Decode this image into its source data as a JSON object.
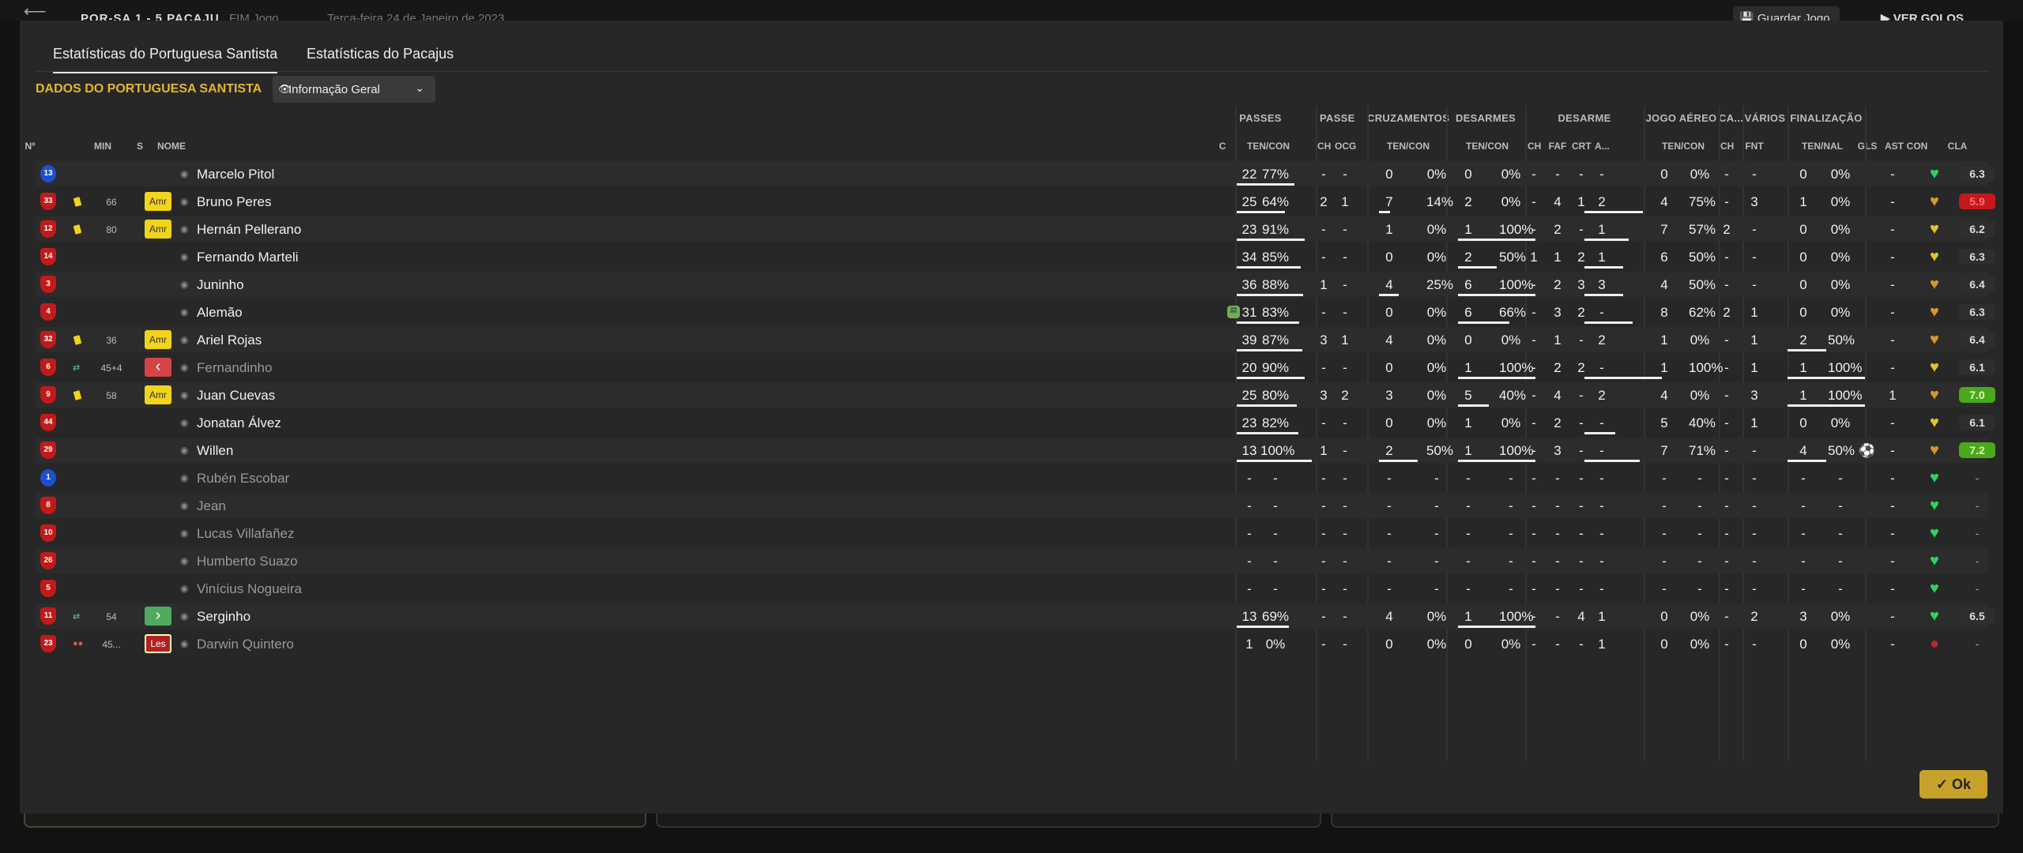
{
  "topbar": {
    "match": "POR-SA  1 - 5  PACAJU",
    "status": "FIM Jogo",
    "date": "Terça-feira 24 de Janeiro de 2023",
    "save": "Guardar Jogo",
    "goals": "VER GOLOS"
  },
  "tabs": [
    "Estatísticas do Portuguesa Santista",
    "Estatísticas do Pacajus"
  ],
  "team_title": "DADOS DO PORTUGUESA SANTISTA",
  "info_button": "Informação Geral",
  "groups": [
    "PASSES",
    "PASSE",
    "CRUZAMENTOS",
    "DESARMES",
    "DESARME",
    "JOGO AÉREO",
    "CA...",
    "VÁRIOS",
    "FINALIZAÇÃO"
  ],
  "columns": [
    "Nº",
    "MIN",
    "S",
    "NOME",
    "C",
    "TEN/CON",
    "CH",
    "OCG",
    "TEN/CON",
    "TEN/CON",
    "CH",
    "FAF",
    "CRT",
    "A...",
    "TEN/CON",
    "CH",
    "FNT",
    "TEN/NAL",
    "GLS",
    "AST",
    "CON",
    "CLA"
  ],
  "players": [
    {
      "num": "13",
      "gk": true,
      "card": false,
      "sub": "",
      "min": "",
      "badge": "",
      "name": "Marcelo Pitol",
      "dim": false,
      "c": false,
      "pass": [
        "22",
        "77%"
      ],
      "pch": "-",
      "ocg": "-",
      "cruz": [
        "0",
        "0%"
      ],
      "des": [
        "0",
        "0%"
      ],
      "dch": "-",
      "faf": "-",
      "crt": "-",
      "a": "-",
      "aer": [
        "0",
        "0%"
      ],
      "cach": "-",
      "fnt": "-",
      "fin": [
        "0",
        "0%"
      ],
      "gls": "",
      "ast": "-",
      "heart": "green",
      "cla": "6.3",
      "cls": "",
      "bars": [
        0.77,
        0,
        0,
        0,
        0,
        0
      ]
    },
    {
      "num": "33",
      "gk": false,
      "card": true,
      "sub": "",
      "min": "66",
      "badge": "Amr",
      "name": "Bruno Peres",
      "dim": false,
      "c": false,
      "pass": [
        "25",
        "64%"
      ],
      "pch": "2",
      "ocg": "1",
      "cruz": [
        "7",
        "14%"
      ],
      "des": [
        "2",
        "0%"
      ],
      "dch": "-",
      "faf": "4",
      "crt": "1",
      "a": "2",
      "aer": [
        "4",
        "75%"
      ],
      "cach": "-",
      "fnt": "3",
      "fin": [
        "1",
        "0%"
      ],
      "gls": "",
      "ast": "-",
      "heart": "orange",
      "cla": "5.9",
      "cls": "red",
      "bars": [
        0.64,
        0,
        0.14,
        0,
        0.75,
        0
      ]
    },
    {
      "num": "12",
      "gk": false,
      "card": true,
      "sub": "",
      "min": "80",
      "badge": "Amr",
      "name": "Hernán Pellerano",
      "dim": false,
      "c": false,
      "pass": [
        "23",
        "91%"
      ],
      "pch": "-",
      "ocg": "-",
      "cruz": [
        "1",
        "0%"
      ],
      "des": [
        "1",
        "100%"
      ],
      "dch": "-",
      "faf": "2",
      "crt": "-",
      "a": "1",
      "aer": [
        "7",
        "57%"
      ],
      "cach": "2",
      "fnt": "-",
      "fin": [
        "0",
        "0%"
      ],
      "gls": "",
      "ast": "-",
      "heart": "yellow",
      "cla": "6.2",
      "cls": "",
      "bars": [
        0.91,
        0,
        0,
        1,
        0.57,
        0
      ]
    },
    {
      "num": "14",
      "gk": false,
      "card": false,
      "sub": "",
      "min": "",
      "badge": "",
      "name": "Fernando Marteli",
      "dim": false,
      "c": false,
      "pass": [
        "34",
        "85%"
      ],
      "pch": "-",
      "ocg": "-",
      "cruz": [
        "0",
        "0%"
      ],
      "des": [
        "2",
        "50%"
      ],
      "dch": "1",
      "faf": "1",
      "crt": "2",
      "a": "1",
      "aer": [
        "6",
        "50%"
      ],
      "cach": "-",
      "fnt": "-",
      "fin": [
        "0",
        "0%"
      ],
      "gls": "",
      "ast": "-",
      "heart": "yellow",
      "cla": "6.3",
      "cls": "",
      "bars": [
        0.85,
        0,
        0,
        0.5,
        0.5,
        0
      ]
    },
    {
      "num": "3",
      "gk": false,
      "card": false,
      "sub": "",
      "min": "",
      "badge": "",
      "name": "Juninho",
      "dim": false,
      "c": false,
      "pass": [
        "36",
        "88%"
      ],
      "pch": "1",
      "ocg": "-",
      "cruz": [
        "4",
        "25%"
      ],
      "des": [
        "6",
        "100%"
      ],
      "dch": "-",
      "faf": "2",
      "crt": "3",
      "a": "3",
      "aer": [
        "4",
        "50%"
      ],
      "cach": "-",
      "fnt": "-",
      "fin": [
        "0",
        "0%"
      ],
      "gls": "",
      "ast": "-",
      "heart": "orange",
      "cla": "6.4",
      "cls": "",
      "bars": [
        0.88,
        0,
        0.25,
        1,
        0.5,
        0
      ]
    },
    {
      "num": "4",
      "gk": false,
      "card": false,
      "sub": "",
      "min": "",
      "badge": "",
      "name": "Alemão",
      "dim": false,
      "c": true,
      "pass": [
        "31",
        "83%"
      ],
      "pch": "-",
      "ocg": "-",
      "cruz": [
        "0",
        "0%"
      ],
      "des": [
        "6",
        "66%"
      ],
      "dch": "-",
      "faf": "3",
      "crt": "2",
      "a": "-",
      "aer": [
        "8",
        "62%"
      ],
      "cach": "2",
      "fnt": "1",
      "fin": [
        "0",
        "0%"
      ],
      "gls": "",
      "ast": "-",
      "heart": "orange",
      "cla": "6.3",
      "cls": "",
      "bars": [
        0.83,
        0,
        0,
        0.66,
        0.62,
        0
      ]
    },
    {
      "num": "32",
      "gk": false,
      "card": true,
      "sub": "",
      "min": "36",
      "badge": "Amr",
      "name": "Ariel Rojas",
      "dim": false,
      "c": false,
      "pass": [
        "39",
        "87%"
      ],
      "pch": "3",
      "ocg": "1",
      "cruz": [
        "4",
        "0%"
      ],
      "des": [
        "0",
        "0%"
      ],
      "dch": "-",
      "faf": "1",
      "crt": "-",
      "a": "2",
      "aer": [
        "1",
        "0%"
      ],
      "cach": "-",
      "fnt": "1",
      "fin": [
        "2",
        "50%"
      ],
      "gls": "",
      "ast": "-",
      "heart": "orange",
      "cla": "6.4",
      "cls": "",
      "bars": [
        0.87,
        0,
        0,
        0,
        0,
        0.5
      ]
    },
    {
      "num": "6",
      "gk": false,
      "card": false,
      "sub": "out",
      "min": "45+4",
      "badge": "out",
      "name": "Fernandinho",
      "dim": true,
      "c": false,
      "pass": [
        "20",
        "90%"
      ],
      "pch": "-",
      "ocg": "-",
      "cruz": [
        "0",
        "0%"
      ],
      "des": [
        "1",
        "100%"
      ],
      "dch": "-",
      "faf": "2",
      "crt": "2",
      "a": "-",
      "aer": [
        "1",
        "100%"
      ],
      "cach": "-",
      "fnt": "1",
      "fin": [
        "1",
        "100%"
      ],
      "gls": "",
      "ast": "-",
      "heart": "yellow",
      "cla": "6.1",
      "cls": "",
      "bars": [
        0.9,
        0,
        0,
        1,
        1,
        1
      ]
    },
    {
      "num": "9",
      "gk": false,
      "card": true,
      "sub": "",
      "min": "58",
      "badge": "Amr",
      "name": "Juan Cuevas",
      "dim": false,
      "c": false,
      "pass": [
        "25",
        "80%"
      ],
      "pch": "3",
      "ocg": "2",
      "cruz": [
        "3",
        "0%"
      ],
      "des": [
        "5",
        "40%"
      ],
      "dch": "-",
      "faf": "4",
      "crt": "-",
      "a": "2",
      "aer": [
        "4",
        "0%"
      ],
      "cach": "-",
      "fnt": "3",
      "fin": [
        "1",
        "100%"
      ],
      "gls": "",
      "ast": "1",
      "heart": "orange",
      "cla": "7.0",
      "cls": "green",
      "bars": [
        0.8,
        0,
        0,
        0.4,
        0,
        1
      ]
    },
    {
      "num": "44",
      "gk": false,
      "card": false,
      "sub": "",
      "min": "",
      "badge": "",
      "name": "Jonatan Álvez",
      "dim": false,
      "c": false,
      "pass": [
        "23",
        "82%"
      ],
      "pch": "-",
      "ocg": "-",
      "cruz": [
        "0",
        "0%"
      ],
      "des": [
        "1",
        "0%"
      ],
      "dch": "-",
      "faf": "2",
      "crt": "-",
      "a": "-",
      "aer": [
        "5",
        "40%"
      ],
      "cach": "-",
      "fnt": "1",
      "fin": [
        "0",
        "0%"
      ],
      "gls": "",
      "ast": "-",
      "heart": "yellow",
      "cla": "6.1",
      "cls": "",
      "bars": [
        0.82,
        0,
        0,
        0,
        0.4,
        0
      ]
    },
    {
      "num": "29",
      "gk": false,
      "card": false,
      "sub": "",
      "min": "",
      "badge": "",
      "name": "Willen",
      "dim": false,
      "c": false,
      "pass": [
        "13",
        "100%"
      ],
      "pch": "1",
      "ocg": "-",
      "cruz": [
        "2",
        "50%"
      ],
      "des": [
        "1",
        "100%"
      ],
      "dch": "-",
      "faf": "3",
      "crt": "-",
      "a": "-",
      "aer": [
        "7",
        "71%"
      ],
      "cach": "-",
      "fnt": "-",
      "fin": [
        "4",
        "50%"
      ],
      "gls": "⚽",
      "ast": "-",
      "heart": "orange",
      "cla": "7.2",
      "cls": "green",
      "bars": [
        1,
        0,
        0.5,
        1,
        0.71,
        0.5
      ]
    },
    {
      "num": "1",
      "gk": true,
      "card": false,
      "sub": "",
      "min": "",
      "badge": "",
      "name": "Rubén Escobar",
      "dim": true,
      "c": false,
      "pass": [
        "-",
        "-"
      ],
      "pch": "-",
      "ocg": "-",
      "cruz": [
        "-",
        "-"
      ],
      "des": [
        "-",
        "-"
      ],
      "dch": "-",
      "faf": "-",
      "crt": "-",
      "a": "-",
      "aer": [
        "-",
        "-"
      ],
      "cach": "-",
      "fnt": "-",
      "fin": [
        "-",
        "-"
      ],
      "gls": "",
      "ast": "-",
      "heart": "green",
      "cla": "-",
      "cls": "none",
      "bars": [
        0,
        0,
        0,
        0,
        0,
        0
      ]
    },
    {
      "num": "8",
      "gk": false,
      "card": false,
      "sub": "",
      "min": "",
      "badge": "",
      "name": "Jean",
      "dim": true,
      "c": false,
      "pass": [
        "-",
        "-"
      ],
      "pch": "-",
      "ocg": "-",
      "cruz": [
        "-",
        "-"
      ],
      "des": [
        "-",
        "-"
      ],
      "dch": "-",
      "faf": "-",
      "crt": "-",
      "a": "-",
      "aer": [
        "-",
        "-"
      ],
      "cach": "-",
      "fnt": "-",
      "fin": [
        "-",
        "-"
      ],
      "gls": "",
      "ast": "-",
      "heart": "green",
      "cla": "-",
      "cls": "none",
      "bars": [
        0,
        0,
        0,
        0,
        0,
        0
      ]
    },
    {
      "num": "10",
      "gk": false,
      "card": false,
      "sub": "",
      "min": "",
      "badge": "",
      "name": "Lucas Villafañez",
      "dim": true,
      "c": false,
      "pass": [
        "-",
        "-"
      ],
      "pch": "-",
      "ocg": "-",
      "cruz": [
        "-",
        "-"
      ],
      "des": [
        "-",
        "-"
      ],
      "dch": "-",
      "faf": "-",
      "crt": "-",
      "a": "-",
      "aer": [
        "-",
        "-"
      ],
      "cach": "-",
      "fnt": "-",
      "fin": [
        "-",
        "-"
      ],
      "gls": "",
      "ast": "-",
      "heart": "green",
      "cla": "-",
      "cls": "none",
      "bars": [
        0,
        0,
        0,
        0,
        0,
        0
      ]
    },
    {
      "num": "26",
      "gk": false,
      "card": false,
      "sub": "",
      "min": "",
      "badge": "",
      "name": "Humberto Suazo",
      "dim": true,
      "c": false,
      "pass": [
        "-",
        "-"
      ],
      "pch": "-",
      "ocg": "-",
      "cruz": [
        "-",
        "-"
      ],
      "des": [
        "-",
        "-"
      ],
      "dch": "-",
      "faf": "-",
      "crt": "-",
      "a": "-",
      "aer": [
        "-",
        "-"
      ],
      "cach": "-",
      "fnt": "-",
      "fin": [
        "-",
        "-"
      ],
      "gls": "",
      "ast": "-",
      "heart": "green",
      "cla": "-",
      "cls": "none",
      "bars": [
        0,
        0,
        0,
        0,
        0,
        0
      ]
    },
    {
      "num": "5",
      "gk": false,
      "card": false,
      "sub": "",
      "min": "",
      "badge": "",
      "name": "Vinícius Nogueira",
      "dim": true,
      "c": false,
      "pass": [
        "-",
        "-"
      ],
      "pch": "-",
      "ocg": "-",
      "cruz": [
        "-",
        "-"
      ],
      "des": [
        "-",
        "-"
      ],
      "dch": "-",
      "faf": "-",
      "crt": "-",
      "a": "-",
      "aer": [
        "-",
        "-"
      ],
      "cach": "-",
      "fnt": "-",
      "fin": [
        "-",
        "-"
      ],
      "gls": "",
      "ast": "-",
      "heart": "green",
      "cla": "-",
      "cls": "none",
      "bars": [
        0,
        0,
        0,
        0,
        0,
        0
      ]
    },
    {
      "num": "11",
      "gk": false,
      "card": false,
      "sub": "in",
      "min": "54",
      "badge": "in",
      "name": "Serginho",
      "dim": false,
      "c": false,
      "pass": [
        "13",
        "69%"
      ],
      "pch": "-",
      "ocg": "-",
      "cruz": [
        "4",
        "0%"
      ],
      "des": [
        "1",
        "100%"
      ],
      "dch": "-",
      "faf": "-",
      "crt": "4",
      "a": "1",
      "aer": [
        "0",
        "0%"
      ],
      "cach": "-",
      "fnt": "2",
      "fin": [
        "3",
        "0%"
      ],
      "gls": "",
      "ast": "-",
      "heart": "green",
      "cla": "6.5",
      "cls": "",
      "bars": [
        0.69,
        0,
        0,
        1,
        0,
        0
      ]
    },
    {
      "num": "23",
      "gk": false,
      "card": false,
      "sub": "inj",
      "min": "45...",
      "badge": "Les",
      "name": "Darwin Quintero",
      "dim": true,
      "c": false,
      "pass": [
        "1",
        "0%"
      ],
      "pch": "-",
      "ocg": "-",
      "cruz": [
        "0",
        "0%"
      ],
      "des": [
        "0",
        "0%"
      ],
      "dch": "-",
      "faf": "-",
      "crt": "-",
      "a": "1",
      "aer": [
        "0",
        "0%"
      ],
      "cach": "-",
      "fnt": "-",
      "fin": [
        "0",
        "0%"
      ],
      "gls": "",
      "ast": "-",
      "heart": "red",
      "cla": "-",
      "cls": "none",
      "bars": [
        0,
        0,
        0,
        0,
        0,
        0
      ]
    }
  ],
  "ok_button": "Ok",
  "colors": {
    "accent": "#e5b62f",
    "gk": "#1d4fd0",
    "outfield": "#c21a1a",
    "ok": "#c7a22b"
  }
}
